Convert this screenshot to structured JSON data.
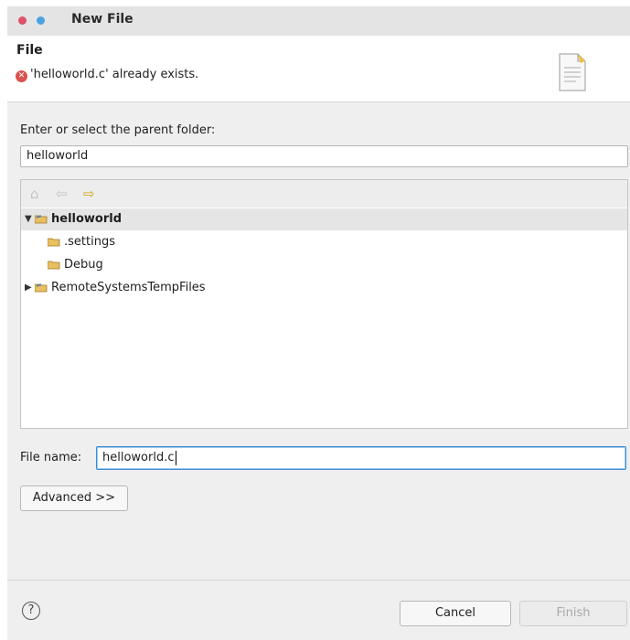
{
  "window": {
    "title": "New File",
    "dot_colors": [
      "#e0506a",
      "#4aa3df"
    ]
  },
  "header": {
    "title": "File",
    "error_message": "'helloworld.c' already exists.",
    "error_icon": "error-x-icon",
    "page_icon": "document-icon"
  },
  "parent_folder": {
    "label": "Enter or select the parent folder:",
    "value": "helloworld"
  },
  "tree": {
    "toolbar": [
      {
        "name": "home-icon",
        "glyph": "⌂",
        "enabled": false
      },
      {
        "name": "back-arrow-icon",
        "glyph": "⇦",
        "enabled": false
      },
      {
        "name": "forward-arrow-icon",
        "glyph": "⇨",
        "enabled": true
      }
    ],
    "items": [
      {
        "label": "helloworld",
        "twisty": "▼",
        "selected": true,
        "project": true
      },
      {
        "label": ".settings",
        "twisty": "",
        "selected": false,
        "project": false
      },
      {
        "label": "Debug",
        "twisty": "",
        "selected": false,
        "project": false
      },
      {
        "label": "RemoteSystemsTempFiles",
        "twisty": "▶",
        "selected": false,
        "project": true
      }
    ]
  },
  "file_name": {
    "label": "File name:",
    "value": "helloworld.c"
  },
  "buttons": {
    "advanced": "Advanced >>",
    "cancel": "Cancel",
    "finish": "Finish",
    "help": "?"
  }
}
